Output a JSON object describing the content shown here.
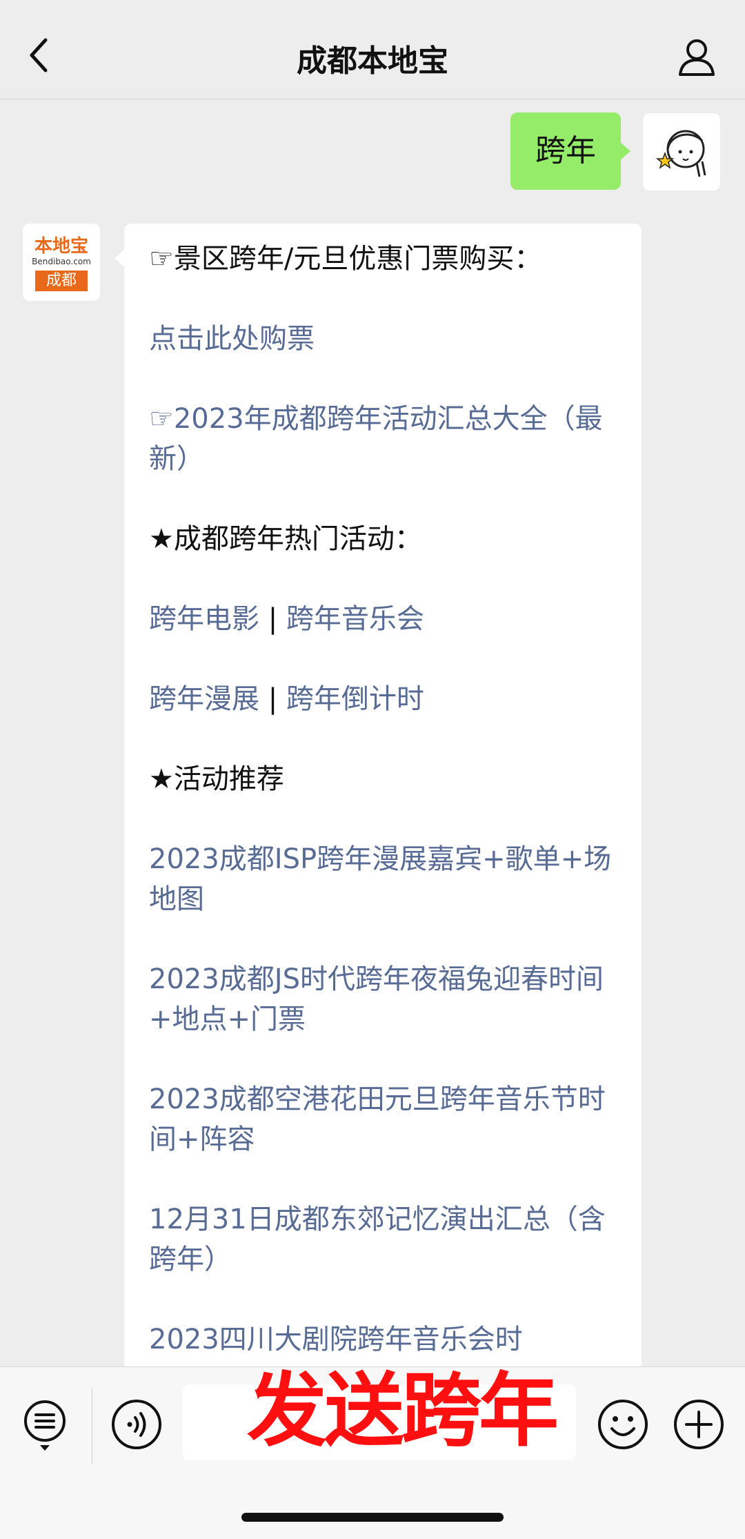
{
  "header": {
    "title": "成都本地宝"
  },
  "chat": {
    "my_message": "跨年",
    "bot_logo": {
      "top": "本地宝",
      "mid": "Bendibao.com",
      "bottom": "成都"
    },
    "lines": [
      {
        "text": "☞景区跨年/元旦优惠门票购买：",
        "link": false
      },
      {
        "text": "点击此处购票",
        "link": true
      },
      {
        "text": "☞2023年成都跨年活动汇总大全（最新）",
        "link": true
      },
      {
        "text": "★成都跨年热门活动：",
        "link": false
      },
      {
        "left": "跨年电影",
        "right": "跨年音乐会",
        "sep": " | "
      },
      {
        "left": "跨年漫展",
        "right": "跨年倒计时",
        "sep": " | "
      },
      {
        "text": "★活动推荐",
        "link": false
      },
      {
        "text": "2023成都ISP跨年漫展嘉宾+歌单+场地图",
        "link": true
      },
      {
        "text": "2023成都JS时代跨年夜福兔迎春时间+地点+门票",
        "link": true
      },
      {
        "text": "2023成都空港花田元旦跨年音乐节时间+阵容",
        "link": true
      },
      {
        "text": "12月31日成都东郊记忆演出汇总（含跨年）",
        "link": true
      },
      {
        "text": "2023四川大剧院跨年音乐会时",
        "link": true
      }
    ]
  },
  "overlay": {
    "send_label": "发送跨年"
  },
  "colors": {
    "my_bubble": "#95ec69",
    "link": "#576b95",
    "overlay_text": "#ff0f0f",
    "logo_orange": "#e9691a"
  }
}
